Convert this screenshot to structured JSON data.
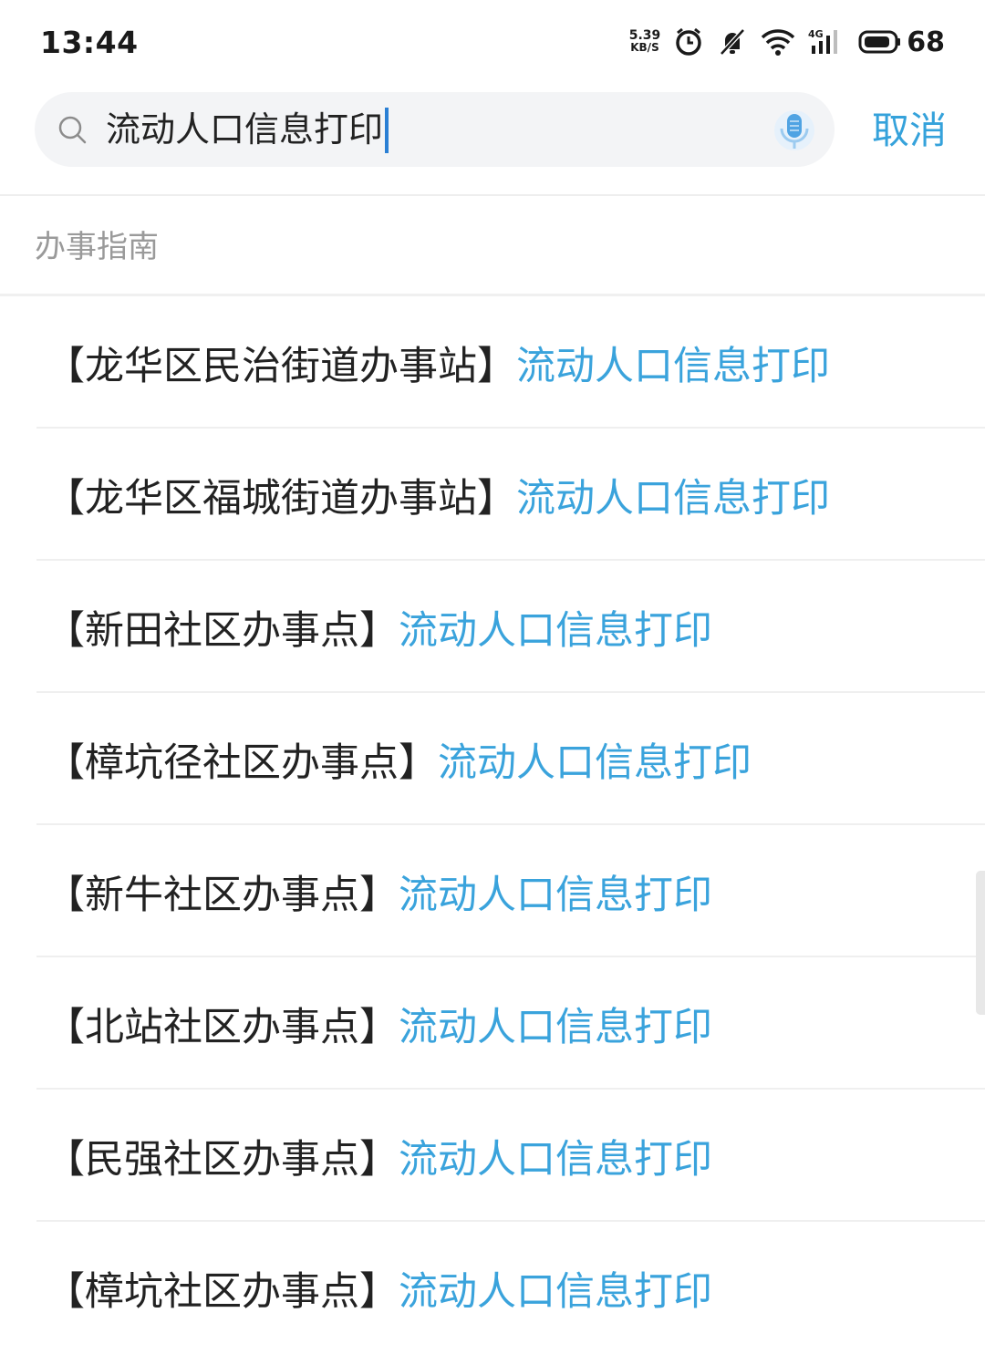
{
  "status_bar": {
    "time": "13:44",
    "net_speed_value": "5.39",
    "net_speed_unit": "KB/S",
    "network_type": "4G",
    "battery_level": "68",
    "icons": [
      "alarm-icon",
      "mute-icon",
      "wifi-icon",
      "signal-icon",
      "battery-icon"
    ]
  },
  "search": {
    "query": "流动人口信息打印",
    "cancel_label": "取消",
    "accent_color": "#35a2db"
  },
  "section": {
    "title": "办事指南"
  },
  "results": [
    {
      "site": "【龙华区民治街道办事站】",
      "title": "流动人口信息打印"
    },
    {
      "site": "【龙华区福城街道办事站】",
      "title": "流动人口信息打印"
    },
    {
      "site": "【新田社区办事点】",
      "title": "流动人口信息打印"
    },
    {
      "site": "【樟坑径社区办事点】",
      "title": "流动人口信息打印"
    },
    {
      "site": "【新牛社区办事点】",
      "title": "流动人口信息打印"
    },
    {
      "site": "【北站社区办事点】",
      "title": "流动人口信息打印"
    },
    {
      "site": "【民强社区办事点】",
      "title": "流动人口信息打印"
    },
    {
      "site": "【樟坑社区办事点】",
      "title": "流动人口信息打印"
    }
  ]
}
